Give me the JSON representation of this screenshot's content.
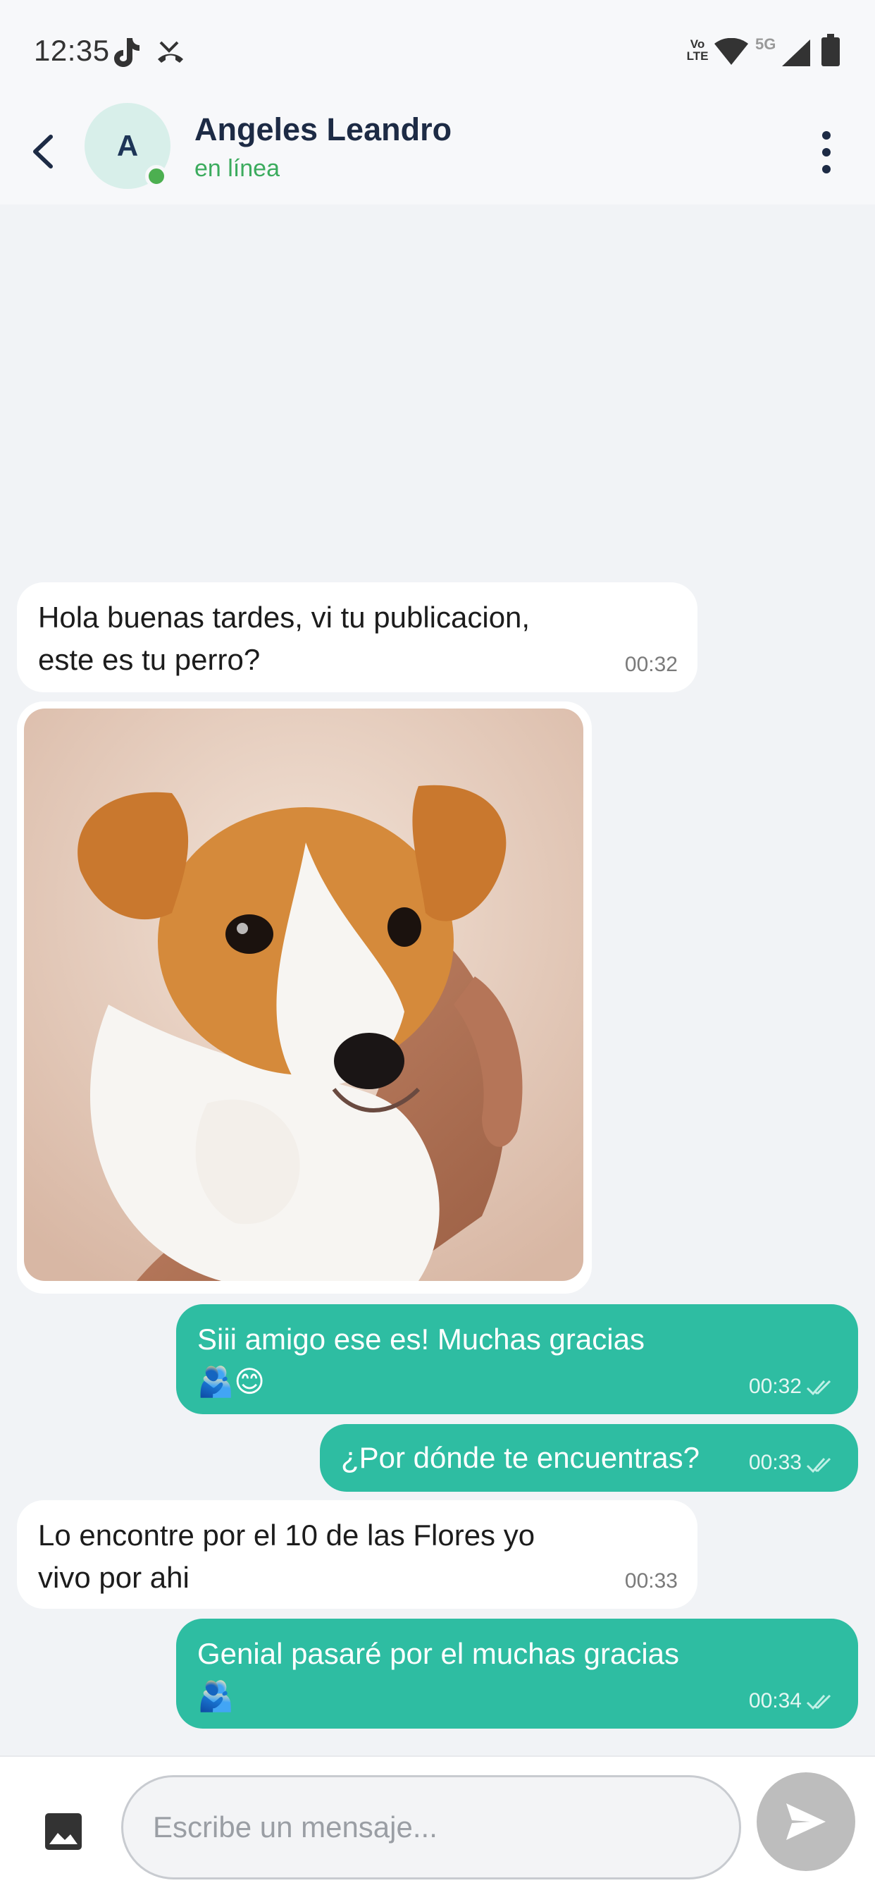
{
  "status_bar": {
    "time": "12:35",
    "left_icons": [
      "tiktok-icon",
      "missed-call-icon"
    ],
    "right_icons": [
      "volte-icon",
      "wifi-icon",
      "5g-icon",
      "signal-icon",
      "battery-icon"
    ],
    "network_label": "5G",
    "volte_label": "Vo LTE"
  },
  "header": {
    "avatar_initial": "A",
    "contact_name": "Angeles Leandro",
    "contact_status": "en línea",
    "online": true
  },
  "messages": [
    {
      "direction": "in",
      "line1": "Hola buenas tardes, vi tu publicacion,",
      "line2": "este es tu perro?",
      "time": "00:32"
    },
    {
      "direction": "in",
      "type": "image",
      "image_desc": "puppy-photo"
    },
    {
      "direction": "out",
      "line1": "Siii amigo ese es! Muchas gracias",
      "line2": "🫂😊",
      "time": "00:32",
      "read": true
    },
    {
      "direction": "out",
      "line1": "¿Por dónde te encuentras?",
      "time": "00:33",
      "read": true
    },
    {
      "direction": "in",
      "line1": "Lo encontre por el 10 de las Flores yo",
      "line2": "vivo por ahi",
      "time": "00:33"
    },
    {
      "direction": "out",
      "line1": "Genial pasaré por el muchas gracias",
      "line2": "🫂",
      "time": "00:34",
      "read": true
    }
  ],
  "composer": {
    "placeholder": "Escribe un mensaje...",
    "value": ""
  },
  "colors": {
    "outgoing_bubble": "#2ebda2",
    "incoming_bubble": "#ffffff",
    "background": "#f1f3f6",
    "online": "#4caf50",
    "send_button": "#bdbdbd"
  }
}
